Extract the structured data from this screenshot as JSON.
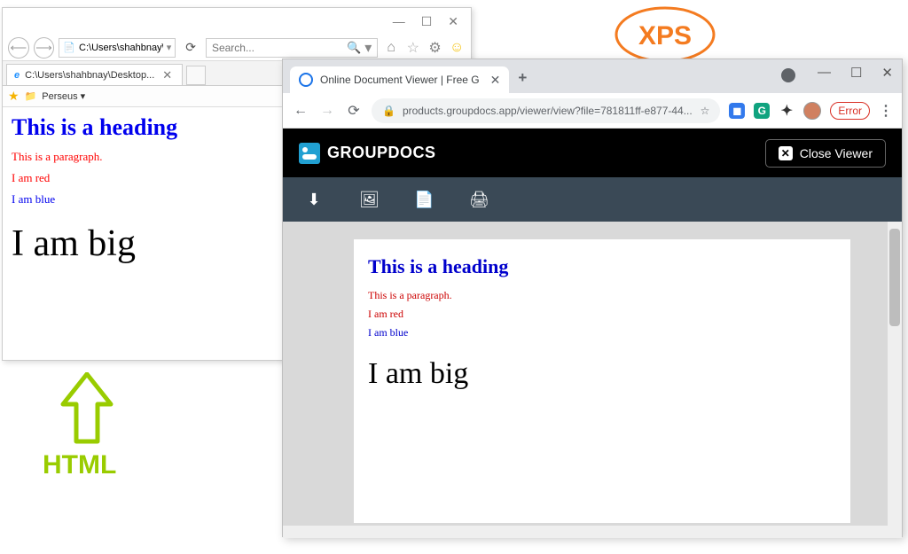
{
  "ie": {
    "address": "C:\\Users\\shahbnay\\De",
    "search_placeholder": "Search...",
    "tab_title": "C:\\Users\\shahbnay\\Desktop...",
    "favorite": "Perseus ▾",
    "doc": {
      "heading": "This is a heading",
      "para": "This is a paragraph.",
      "red": "I am red",
      "blue": "I am blue",
      "big": "I am big"
    }
  },
  "chrome": {
    "tab_title": "Online Document Viewer | Free G",
    "url": "products.groupdocs.app/viewer/view?file=781811ff-e877-44...",
    "error_label": "Error"
  },
  "groupdocs": {
    "brand": "GROUPDOCS",
    "close_label": "Close Viewer",
    "doc": {
      "heading": "This is a heading",
      "para": "This is a paragraph.",
      "red": "I am red",
      "blue": "I am blue",
      "big": "I am big"
    }
  },
  "labels": {
    "html": "HTML",
    "xps": "XPS"
  }
}
